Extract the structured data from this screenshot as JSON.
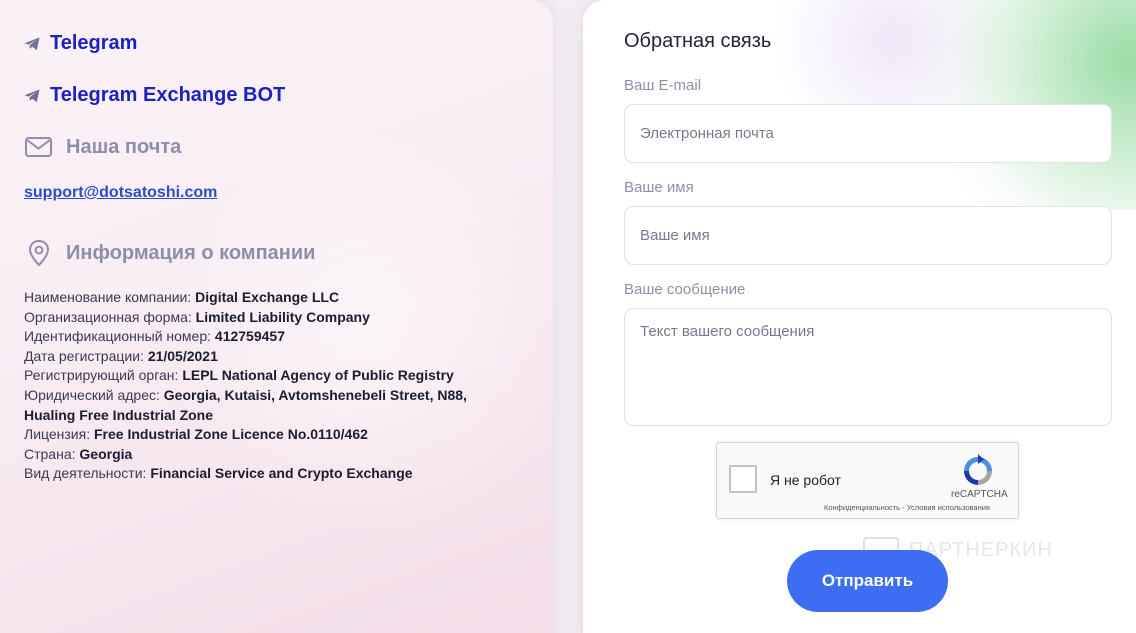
{
  "contacts": {
    "telegram_label": "Telegram",
    "telegram_bot_label": "Telegram Exchange BOT",
    "mail_heading": "Наша почта",
    "email": "support@dotsatoshi.com",
    "company_heading": "Информация о компании"
  },
  "company_info": [
    {
      "key": "Наименование компании: ",
      "value": "Digital Exchange LLC"
    },
    {
      "key": "Организационная форма: ",
      "value": "Limited Liability Company"
    },
    {
      "key": "Идентификационный номер: ",
      "value": "412759457"
    },
    {
      "key": "Дата регистрации: ",
      "value": "21/05/2021"
    },
    {
      "key": "Регистрирующий орган: ",
      "value": "LEPL National Agency of Public Registry"
    },
    {
      "key": "Юридический адрес: ",
      "value": "Georgia, Kutaisi, Avtomshenebeli Street, N88, Hualing Free Industrial Zone"
    },
    {
      "key": "Лицензия: ",
      "value": "Free Industrial Zone Licence No.0110/462"
    },
    {
      "key": "Страна: ",
      "value": "Georgia"
    },
    {
      "key": "Вид деятельности: ",
      "value": "Financial Service and Crypto Exchange"
    }
  ],
  "form": {
    "title": "Обратная связь",
    "email_label": "Ваш E-mail",
    "email_placeholder": "Электронная почта",
    "email_value": "",
    "name_label": "Ваше имя",
    "name_placeholder": "Ваше имя",
    "name_value": "",
    "message_label": "Ваше сообщение",
    "message_placeholder": "Текст вашего сообщения",
    "message_value": "",
    "captcha_text": "Я не робот",
    "captcha_brand": "reCAPTCHA",
    "captcha_links": "Конфиденциальность - Условия использования",
    "submit_label": "Отправить"
  },
  "watermark": "ПАРТНЕРКИН",
  "colors": {
    "accent": "#3d6df3",
    "link": "#1a22c4",
    "muted_heading": "#8d8fa8"
  }
}
